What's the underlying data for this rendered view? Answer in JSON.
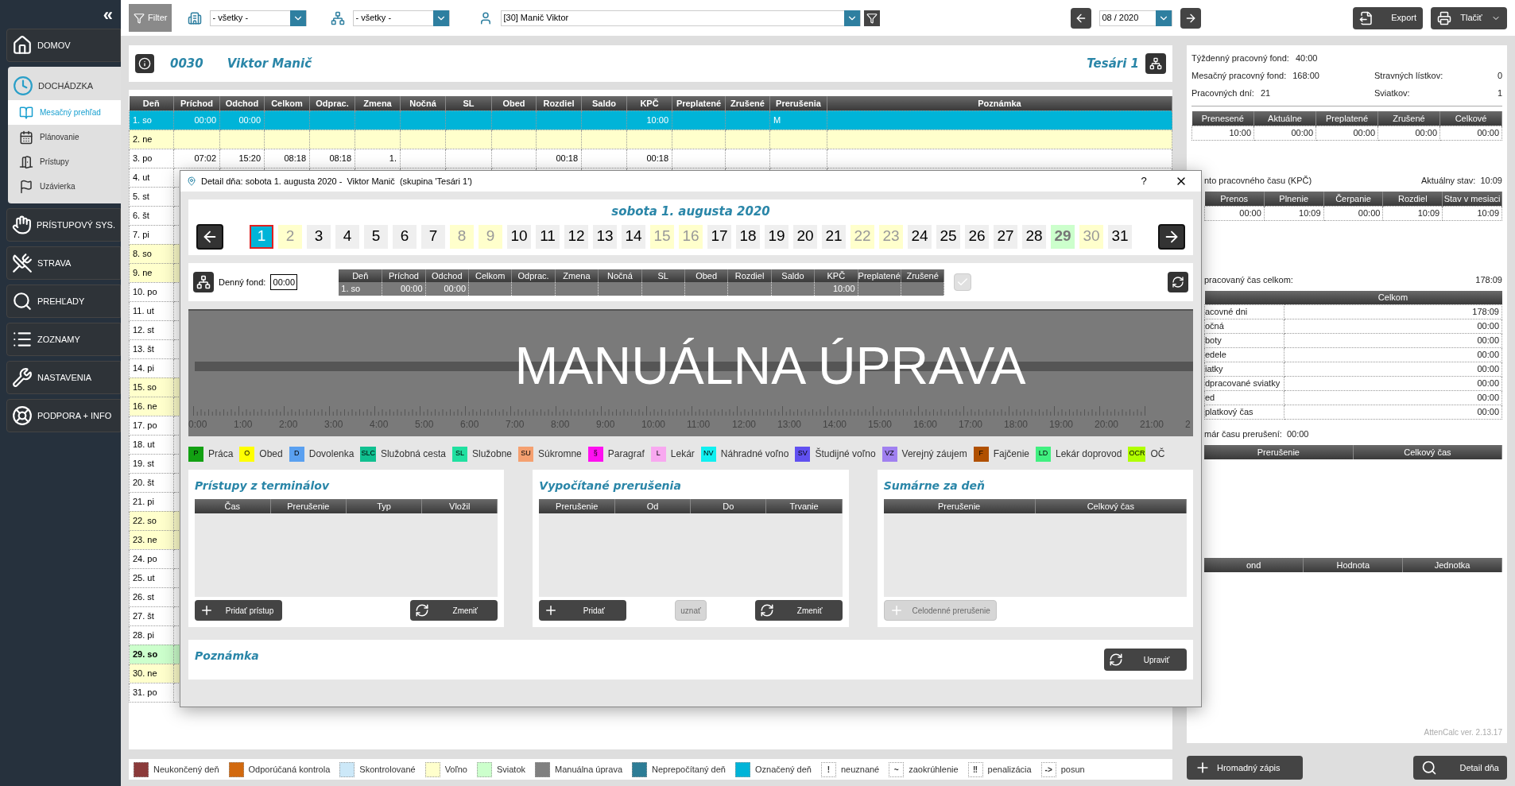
{
  "sidebar": {
    "collapse": "«",
    "items": [
      {
        "label": "DOMOV",
        "expanded": false
      },
      {
        "label": "DOCHÁDZKA",
        "expanded": true,
        "children": [
          {
            "label": "Mesačný prehľad",
            "selected": true
          },
          {
            "label": "Plánovanie",
            "selected": false
          },
          {
            "label": "Prístupy",
            "selected": false
          },
          {
            "label": "Uzávierka",
            "selected": false
          }
        ]
      },
      {
        "label": "PRÍSTUPOVÝ SYS.",
        "expanded": false
      },
      {
        "label": "STRAVA",
        "expanded": false
      },
      {
        "label": "PREHĽADY",
        "expanded": false
      },
      {
        "label": "ZOZNAMY",
        "expanded": false
      },
      {
        "label": "NASTAVENIA",
        "expanded": false
      },
      {
        "label": "PODPORA + INFO",
        "expanded": false
      }
    ]
  },
  "toolbar": {
    "filter": "Filter",
    "department": "- všetky -",
    "group": "- všetky -",
    "employee": "[30] Manič Viktor",
    "period": "08 / 2020",
    "export": "Export",
    "print": "Tlačiť"
  },
  "employee": {
    "number": "0030",
    "name": "Viktor Manič",
    "group": "Tesári 1"
  },
  "table": {
    "columns": [
      "Deň",
      "Príchod",
      "Odchod",
      "Celkom",
      "Odprac.",
      "Zmena",
      "Nočná",
      "SL",
      "Obed",
      "Rozdiel",
      "Saldo",
      "KPČ",
      "Preplatené",
      "Zrušené",
      "Prerušenia",
      "Poznámka"
    ],
    "rows": [
      {
        "day": "1. so",
        "selected": true,
        "arrival": "00:00",
        "departure": "00:00",
        "kpc": "10:00",
        "breaks": "M"
      },
      {
        "day": "2. ne",
        "kind": "free",
        "selected": false
      },
      {
        "day": "3. po",
        "kind": "work",
        "selected": false,
        "arrival": "07:02",
        "departure": "15:20",
        "total": "08:18",
        "worked": "08:18",
        "shift": "1.",
        "diff": "00:18",
        "kpc": "00:18"
      },
      {
        "day": "4. ut",
        "kind": "work",
        "selected": false
      },
      {
        "day": "5. st",
        "kind": "work",
        "selected": false
      },
      {
        "day": "6. št",
        "kind": "work",
        "selected": false
      },
      {
        "day": "7. pi",
        "kind": "work",
        "selected": false
      },
      {
        "day": "8. so",
        "kind": "free",
        "selected": false
      },
      {
        "day": "9. ne",
        "kind": "free",
        "selected": false
      },
      {
        "day": "10. po",
        "kind": "work",
        "selected": false
      },
      {
        "day": "11. ut",
        "kind": "work",
        "selected": false
      },
      {
        "day": "12. st",
        "kind": "work",
        "selected": false
      },
      {
        "day": "13. št",
        "kind": "work",
        "selected": false
      },
      {
        "day": "14. pi",
        "kind": "work",
        "selected": false
      },
      {
        "day": "15. so",
        "kind": "free",
        "selected": false
      },
      {
        "day": "16. ne",
        "kind": "free",
        "selected": false
      },
      {
        "day": "17. po",
        "kind": "work",
        "selected": false
      },
      {
        "day": "18. ut",
        "kind": "work",
        "selected": false
      },
      {
        "day": "19. st",
        "kind": "work",
        "selected": false
      },
      {
        "day": "20. št",
        "kind": "work",
        "selected": false
      },
      {
        "day": "21. pi",
        "kind": "work",
        "selected": false
      },
      {
        "day": "22. so",
        "kind": "free",
        "selected": false
      },
      {
        "day": "23. ne",
        "kind": "free",
        "selected": false
      },
      {
        "day": "24. po",
        "kind": "work",
        "selected": false
      },
      {
        "day": "25. ut",
        "kind": "work",
        "selected": false
      },
      {
        "day": "26. st",
        "kind": "work",
        "selected": false
      },
      {
        "day": "27. št",
        "kind": "work",
        "selected": false
      },
      {
        "day": "28. pi",
        "kind": "work",
        "selected": false
      },
      {
        "day": "29. so",
        "kind": "holiday",
        "selected": false
      },
      {
        "day": "30. ne",
        "kind": "free",
        "selected": false
      },
      {
        "day": "31. po",
        "kind": "work",
        "selected": false
      }
    ]
  },
  "legend": [
    {
      "kind": "swatch",
      "color": "#8b3a3a",
      "label": "Neukončený deň"
    },
    {
      "kind": "swatch",
      "color": "#d2690e",
      "label": "Odporúčaná kontrola"
    },
    {
      "kind": "swatch",
      "color": "#cce8f8",
      "label": "Skontrolované"
    },
    {
      "kind": "swatch",
      "color": "#ffffcc",
      "label": "Voľno"
    },
    {
      "kind": "swatch",
      "color": "#ccffcc",
      "label": "Sviatok"
    },
    {
      "kind": "swatch",
      "color": "#808080",
      "label": "Manuálna úprava"
    },
    {
      "kind": "swatch",
      "color": "#2d7d96",
      "label": "Neprepočítaný deň"
    },
    {
      "kind": "swatch",
      "color": "#00b4d8",
      "label": "Označený deň"
    },
    {
      "kind": "symbol",
      "symbol": "!",
      "label": "neuznané"
    },
    {
      "kind": "symbol",
      "symbol": "~",
      "label": "zaokrúhlenie"
    },
    {
      "kind": "symbol",
      "symbol": "‼",
      "label": "penalizácia"
    },
    {
      "kind": "symbol",
      "symbol": "->",
      "label": "posun"
    }
  ],
  "summary": {
    "lines": [
      [
        [
          "Týždenný pracovný fond:",
          "40:00"
        ]
      ],
      [
        [
          "Mesačný pracovný fond:",
          "168:00"
        ],
        [
          "Stravných lístkov:",
          "0"
        ]
      ],
      [
        [
          "Pracovných dní:",
          "21"
        ],
        [
          "Sviatkov:",
          "1"
        ]
      ]
    ],
    "balance": {
      "columns": [
        "Prenesené",
        "Aktuálne",
        "Preplatené",
        "Zrušené",
        "Celkové"
      ],
      "values": [
        "10:00",
        "00:00",
        "00:00",
        "00:00",
        "00:00"
      ]
    },
    "kpc_title": "nto pracovného času (KPČ)",
    "kpc_state": "Aktuálny stav:  10:09",
    "kpc": {
      "columns": [
        "Prenos",
        "Plnenie",
        "Čerpanie",
        "Rozdiel",
        "Stav v mesiaci"
      ],
      "values": [
        "00:00",
        "10:09",
        "00:00",
        "10:09",
        "10:09"
      ]
    },
    "worked_title": "pracovaný čas celkom:",
    "worked_total": "178:09",
    "worked_column": "Celkom",
    "worked_rows": [
      [
        "acovné dni",
        "178:09"
      ],
      [
        "očná",
        "00:00"
      ],
      [
        "boty",
        "00:00"
      ],
      [
        "edele",
        "00:00"
      ],
      [
        "iatky",
        "00:00"
      ],
      [
        "dpracované sviatky",
        "00:00"
      ],
      [
        "ed",
        "00:00"
      ],
      [
        "platkový čas",
        "00:00"
      ]
    ],
    "breaks_title": "már času prerušení:  00:00",
    "breaks_columns": [
      "Prerušenie",
      "Celkový čas"
    ],
    "fund_columns": [
      "ond",
      "Hodnota",
      "Jednotka"
    ],
    "version": "AttenCalc ver. 2.13.17"
  },
  "bottom_buttons": [
    "Hromadný zápis",
    "Detail dňa"
  ],
  "dialog": {
    "title": "Detail dňa: sobota 1. augusta 2020 -  Viktor Manič  (skupina 'Tesári 1')",
    "help": "?",
    "date": "sobota 1. augusta 2020",
    "days": [
      {
        "n": "1",
        "selected": true
      },
      {
        "n": "2",
        "kind": "free",
        "selected": false
      },
      {
        "n": "3",
        "kind": "work",
        "selected": false
      },
      {
        "n": "4",
        "kind": "work",
        "selected": false
      },
      {
        "n": "5",
        "kind": "work",
        "selected": false
      },
      {
        "n": "6",
        "kind": "work",
        "selected": false
      },
      {
        "n": "7",
        "kind": "work",
        "selected": false
      },
      {
        "n": "8",
        "kind": "free",
        "selected": false
      },
      {
        "n": "9",
        "kind": "free",
        "selected": false
      },
      {
        "n": "10",
        "kind": "work",
        "selected": false
      },
      {
        "n": "11",
        "kind": "work",
        "selected": false
      },
      {
        "n": "12",
        "kind": "work",
        "selected": false
      },
      {
        "n": "13",
        "kind": "work",
        "selected": false
      },
      {
        "n": "14",
        "kind": "work",
        "selected": false
      },
      {
        "n": "15",
        "kind": "free",
        "selected": false
      },
      {
        "n": "16",
        "kind": "free",
        "selected": false
      },
      {
        "n": "17",
        "kind": "work",
        "selected": false
      },
      {
        "n": "18",
        "kind": "work",
        "selected": false
      },
      {
        "n": "19",
        "kind": "work",
        "selected": false
      },
      {
        "n": "20",
        "kind": "work",
        "selected": false
      },
      {
        "n": "21",
        "kind": "work",
        "selected": false
      },
      {
        "n": "22",
        "kind": "free",
        "selected": false
      },
      {
        "n": "23",
        "kind": "free",
        "selected": false
      },
      {
        "n": "24",
        "kind": "work",
        "selected": false
      },
      {
        "n": "25",
        "kind": "work",
        "selected": false
      },
      {
        "n": "26",
        "kind": "work",
        "selected": false
      },
      {
        "n": "27",
        "kind": "work",
        "selected": false
      },
      {
        "n": "28",
        "kind": "work",
        "selected": false
      },
      {
        "n": "29",
        "kind": "holiday",
        "selected": false
      },
      {
        "n": "30",
        "kind": "free",
        "selected": false
      },
      {
        "n": "31",
        "kind": "work",
        "selected": false
      }
    ],
    "fund_label": "Denný fond:",
    "fund_value": "00:00",
    "day_columns": [
      "Deň",
      "Príchod",
      "Odchod",
      "Celkom",
      "Odprac.",
      "Zmena",
      "Nočná",
      "SL",
      "Obed",
      "Rozdiel",
      "Saldo",
      "KPČ",
      "Preplatené",
      "Zrušené"
    ],
    "day_row": {
      "day": "1. so",
      "arrival": "00:00",
      "departure": "00:00",
      "kpc": "10:00"
    },
    "confirmed": false,
    "overlay": "MANUÁLNA ÚPRAVA",
    "hours": [
      "0:00",
      "1:00",
      "2:00",
      "3:00",
      "4:00",
      "5:00",
      "6:00",
      "7:00",
      "8:00",
      "9:00",
      "10:00",
      "11:00",
      "12:00",
      "13:00",
      "14:00",
      "15:00",
      "16:00",
      "17:00",
      "18:00",
      "19:00",
      "20:00",
      "21:00",
      "2"
    ],
    "types": [
      {
        "code": "P",
        "label": "Práca",
        "color": "#12a012"
      },
      {
        "code": "O",
        "label": "Obed",
        "color": "#ffff00"
      },
      {
        "code": "D",
        "label": "Dovolenka",
        "color": "#5aa0f0"
      },
      {
        "code": "SLC",
        "label": "Služobná cesta",
        "color": "#10c090"
      },
      {
        "code": "SL",
        "label": "Služobne",
        "color": "#20e0a0"
      },
      {
        "code": "SU",
        "label": "Súkromne",
        "color": "#f5a070"
      },
      {
        "code": "§",
        "label": "Paragraf",
        "color": "#ff10f0"
      },
      {
        "code": "L",
        "label": "Lekár",
        "color": "#f8a8f0"
      },
      {
        "code": "NV",
        "label": "Náhradné voľno",
        "color": "#10f0f0"
      },
      {
        "code": "SV",
        "label": "Študijné voľno",
        "color": "#6050f0"
      },
      {
        "code": "VZ",
        "label": "Verejný záujem",
        "color": "#a080f0"
      },
      {
        "code": "F",
        "label": "Fajčenie",
        "color": "#b05000"
      },
      {
        "code": "LD",
        "label": "Lekár doprovod",
        "color": "#40f080"
      },
      {
        "code": "OCR",
        "label": "OČ",
        "color": "#b0ff00"
      }
    ],
    "cards": [
      {
        "title": "Prístupy z terminálov",
        "columns": [
          "Čas",
          "Prerušenie",
          "Typ",
          "Vložil"
        ],
        "buttons": [
          {
            "label": "Pridať prístup",
            "kind": "add",
            "disabled": false
          },
          {
            "label": "Zmeniť",
            "kind": "change",
            "disabled": false
          }
        ]
      },
      {
        "title": "Vypočítané prerušenia",
        "columns": [
          "Prerušenie",
          "Od",
          "Do",
          "Trvanie"
        ],
        "buttons": [
          {
            "label": "Pridať",
            "kind": "add",
            "disabled": false
          },
          {
            "label": "uznať",
            "kind": "plain",
            "disabled": true
          },
          {
            "label": "Zmeniť",
            "kind": "change",
            "disabled": false
          }
        ]
      },
      {
        "title": "Sumárne za deň",
        "columns": [
          "Prerušenie",
          "Celkový čas"
        ],
        "buttons": [
          {
            "label": "Celodenné prerušenie",
            "kind": "add",
            "disabled": true
          }
        ]
      }
    ],
    "note_title": "Poznámka",
    "note_button": "Upraviť"
  }
}
